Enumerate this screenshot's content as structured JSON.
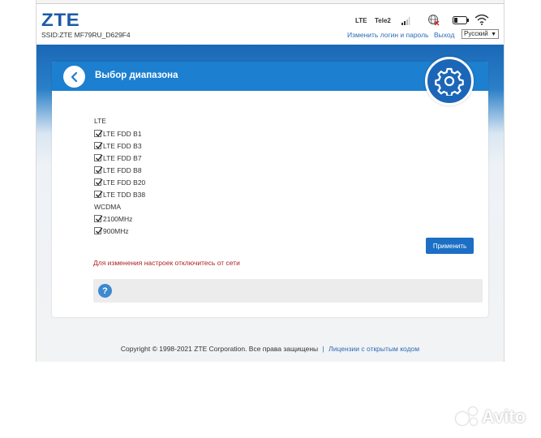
{
  "header": {
    "logo": "ZTE",
    "ssid": "SSID:ZTE MF79RU_D629F4",
    "network_type": "LTE",
    "operator": "Tele2",
    "change_login_link": "Изменить логин и пароль",
    "logout_link": "Выход",
    "language": "Русский",
    "icons": [
      "signal-icon",
      "globe-icon",
      "battery-icon",
      "wifi-icon"
    ]
  },
  "panel": {
    "title": "Выбор диапазона",
    "lte_label": "LTE",
    "lte_bands": [
      {
        "label": "LTE FDD B1",
        "checked": true
      },
      {
        "label": "LTE FDD B3",
        "checked": true
      },
      {
        "label": "LTE FDD B7",
        "checked": true
      },
      {
        "label": "LTE FDD B8",
        "checked": true
      },
      {
        "label": "LTE FDD B20",
        "checked": true
      },
      {
        "label": "LTE TDD B38",
        "checked": true
      }
    ],
    "wcdma_label": "WCDMA",
    "wcdma_bands": [
      {
        "label": "2100MHz",
        "checked": true
      },
      {
        "label": "900MHz",
        "checked": true
      }
    ],
    "apply_button": "Применить",
    "warning": "Для изменения настроек отключитесь от сети",
    "help_icon": "?"
  },
  "footer": {
    "copyright": "Copyright © 1998-2021 ZTE Corporation. Все права защищены",
    "separator": "|",
    "license_link": "Лицензии с открытым кодом"
  },
  "watermark": "Avito",
  "colors": {
    "brand_blue": "#1c7fd0",
    "link_blue": "#2a6bb8",
    "warning_red": "#b02020"
  }
}
